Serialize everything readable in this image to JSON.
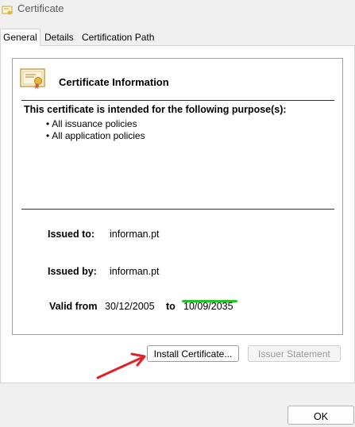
{
  "window": {
    "title": "Certificate",
    "icon": "certificate-icon"
  },
  "tabs": [
    {
      "label": "General",
      "active": true
    },
    {
      "label": "Details",
      "active": false
    },
    {
      "label": "Certification Path",
      "active": false
    }
  ],
  "info": {
    "icon": "certificate-icon",
    "title": "Certificate Information",
    "purpose_heading": "This certificate is intended for the following purpose(s):",
    "purposes": [
      "All issuance policies",
      "All application policies"
    ],
    "issued_to_label": "Issued to:",
    "issued_to_value": "informan.pt",
    "issued_by_label": "Issued by:",
    "issued_by_value": "informan.pt",
    "valid_from_label": "Valid from",
    "valid_from_value": "30/12/2005",
    "valid_to_label": "to",
    "valid_to_value": "10/09/2035"
  },
  "buttons": {
    "install_label": "Install Certificate...",
    "issuer_statement_label": "Issuer Statement",
    "ok_label": "OK"
  },
  "annotations": {
    "arrow_color": "#e0202a",
    "underline_color": "#25c425"
  }
}
